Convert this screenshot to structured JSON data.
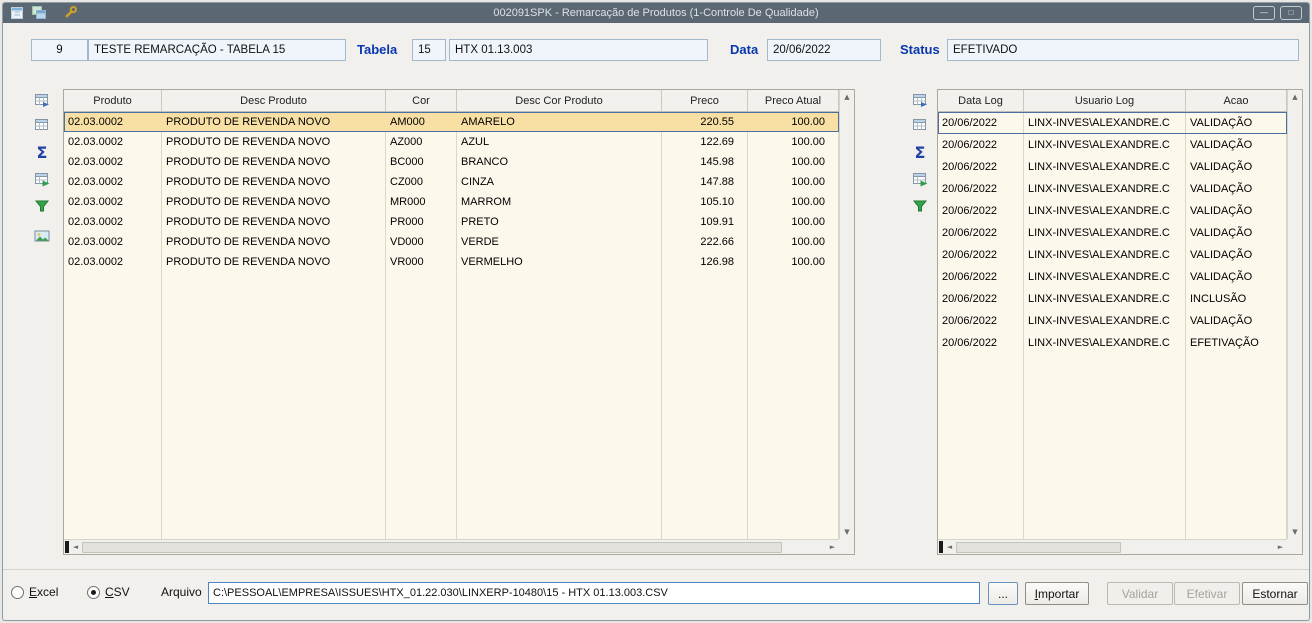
{
  "window": {
    "title": "002091SPK - Remarcação de Produtos (1-Controle De Qualidade)",
    "minimize_glyph": "—",
    "maximize_glyph": "□",
    "titlebar_icons": [
      "form-icon",
      "windows-icon",
      "wrench-icon"
    ]
  },
  "header": {
    "record_id": "9",
    "record_name": "TESTE REMARCAÇÃO - TABELA 15",
    "tabela_label": "Tabela",
    "tabela_numero": "15",
    "tabela_nome": "HTX 01.13.003",
    "data_label": "Data",
    "data_value": "20/06/2022",
    "status_label": "Status",
    "status_value": "EFETIVADO"
  },
  "left_toolbar": {
    "icons": [
      "export-grid-icon",
      "grid-icon",
      "sum-icon",
      "grid-refresh-icon",
      "filter-icon",
      "image-icon"
    ]
  },
  "right_toolbar": {
    "icons": [
      "export-grid-icon",
      "grid-icon",
      "sum-icon",
      "grid-refresh-icon",
      "filter-icon"
    ]
  },
  "products_grid": {
    "columns": [
      "Produto",
      "Desc Produto",
      "Cor",
      "Desc Cor Produto",
      "Preco",
      "Preco Atual"
    ],
    "rows": [
      [
        "02.03.0002",
        "PRODUTO DE REVENDA NOVO",
        "AM000",
        "AMARELO",
        "220.55",
        "100.00"
      ],
      [
        "02.03.0002",
        "PRODUTO DE REVENDA NOVO",
        "AZ000",
        "AZUL",
        "122.69",
        "100.00"
      ],
      [
        "02.03.0002",
        "PRODUTO DE REVENDA NOVO",
        "BC000",
        "BRANCO",
        "145.98",
        "100.00"
      ],
      [
        "02.03.0002",
        "PRODUTO DE REVENDA NOVO",
        "CZ000",
        "CINZA",
        "147.88",
        "100.00"
      ],
      [
        "02.03.0002",
        "PRODUTO DE REVENDA NOVO",
        "MR000",
        "MARROM",
        "105.10",
        "100.00"
      ],
      [
        "02.03.0002",
        "PRODUTO DE REVENDA NOVO",
        "PR000",
        "PRETO",
        "109.91",
        "100.00"
      ],
      [
        "02.03.0002",
        "PRODUTO DE REVENDA NOVO",
        "VD000",
        "VERDE",
        "222.66",
        "100.00"
      ],
      [
        "02.03.0002",
        "PRODUTO DE REVENDA NOVO",
        "VR000",
        "VERMELHO",
        "126.98",
        "100.00"
      ]
    ]
  },
  "log_grid": {
    "columns": [
      "Data Log",
      "Usuario Log",
      "Acao"
    ],
    "rows": [
      [
        "20/06/2022",
        "LINX-INVES\\ALEXANDRE.C",
        "VALIDAÇÃO"
      ],
      [
        "20/06/2022",
        "LINX-INVES\\ALEXANDRE.C",
        "VALIDAÇÃO"
      ],
      [
        "20/06/2022",
        "LINX-INVES\\ALEXANDRE.C",
        "VALIDAÇÃO"
      ],
      [
        "20/06/2022",
        "LINX-INVES\\ALEXANDRE.C",
        "VALIDAÇÃO"
      ],
      [
        "20/06/2022",
        "LINX-INVES\\ALEXANDRE.C",
        "VALIDAÇÃO"
      ],
      [
        "20/06/2022",
        "LINX-INVES\\ALEXANDRE.C",
        "VALIDAÇÃO"
      ],
      [
        "20/06/2022",
        "LINX-INVES\\ALEXANDRE.C",
        "VALIDAÇÃO"
      ],
      [
        "20/06/2022",
        "LINX-INVES\\ALEXANDRE.C",
        "VALIDAÇÃO"
      ],
      [
        "20/06/2022",
        "LINX-INVES\\ALEXANDRE.C",
        "INCLUSÃO"
      ],
      [
        "20/06/2022",
        "LINX-INVES\\ALEXANDRE.C",
        "VALIDAÇÃO"
      ],
      [
        "20/06/2022",
        "LINX-INVES\\ALEXANDRE.C",
        "EFETIVAÇÃO"
      ]
    ]
  },
  "glyphs": {
    "up": "▲",
    "down": "▼",
    "left": "◄",
    "right": "►",
    "sum": "Σ"
  },
  "footer": {
    "excel_label": "Excel",
    "csv_label": "CSV",
    "selected_format": "CSV",
    "arquivo_label": "Arquivo",
    "arquivo_path": "C:\\PESSOAL\\EMPRESA\\ISSUES\\HTX_01.22.030\\LINXERP-10480\\15 - HTX 01.13.003.CSV",
    "browse_label": "...",
    "importar_label": "Importar",
    "validar_label": "Validar",
    "efetivar_label": "Efetivar",
    "estornar_label": "Estornar"
  },
  "colors": {
    "titlebar": "#5B6873",
    "grid_background": "#FCF8EB",
    "selected_row": "#F8E0A4",
    "field_background": "#EFF5FB",
    "label_blue": "#0837AE",
    "filter_green": "#33A34C"
  }
}
